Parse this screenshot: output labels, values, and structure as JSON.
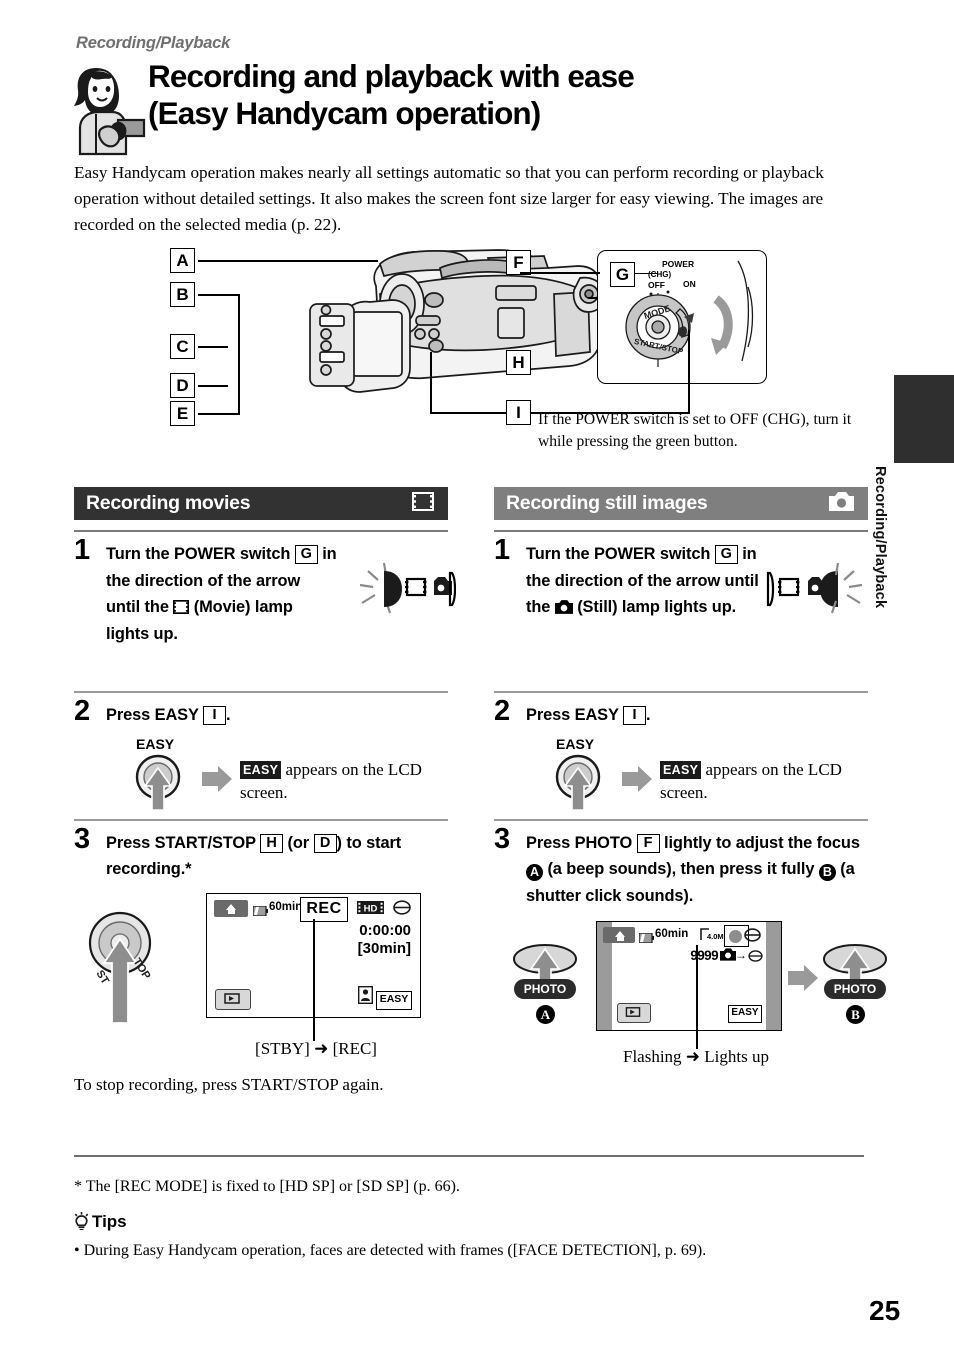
{
  "header": {
    "kicker": "Recording/Playback",
    "title_line1": "Recording and playback with ease",
    "title_line2": "(Easy Handycam operation)",
    "intro": "Easy Handycam operation makes nearly all settings automatic so that you can perform recording or playback operation without detailed settings. It also makes the screen font size larger for easy viewing. The images are recorded on the selected media (p. 22)."
  },
  "side_tab": {
    "label": "Recording/Playback"
  },
  "diagram": {
    "callouts": [
      "A",
      "B",
      "C",
      "D",
      "E",
      "F",
      "H",
      "I"
    ],
    "power_panel": {
      "callout": "G",
      "power_label": "POWER",
      "chg_label": "(CHG)",
      "off_label": "OFF",
      "on_label": "ON",
      "mode_label": "MODE",
      "startstop_label": "START/STOP"
    },
    "note": "If the POWER switch is set to OFF (CHG), turn it while pressing the green button."
  },
  "columns": [
    {
      "section_title": "Recording movies",
      "section_icon": "movie-icon",
      "header_style": "dark",
      "steps": [
        {
          "num": "1",
          "text_parts": [
            "Turn the POWER switch ",
            "G",
            " in the direction of the arrow until the ",
            "movie-icon",
            " (Movie) lamp lights up."
          ],
          "lamp_active": "movie"
        },
        {
          "num": "2",
          "text_pre": "Press EASY ",
          "text_box": "I",
          "text_post": ".",
          "button_label": "EASY",
          "caption_chip": "EASY",
          "caption_text": " appears on the LCD screen."
        },
        {
          "num": "3",
          "text_parts": [
            "Press START/STOP ",
            "H",
            " (or ",
            "D",
            ") to start recording.*"
          ],
          "lcd": {
            "battery": "60min",
            "rec_badge": "REC",
            "format": "HD",
            "timecode": "0:00:00",
            "remaining": "[30min]",
            "easy_tag": "EASY"
          },
          "caption": "[STBY] ➜ [REC]",
          "after_text": "To stop recording, press START/STOP again."
        }
      ]
    },
    {
      "section_title": "Recording still images",
      "section_icon": "still-icon",
      "header_style": "gray",
      "steps": [
        {
          "num": "1",
          "text_parts": [
            "Turn the POWER switch ",
            "G",
            " in the direction of the arrow until the ",
            "still-icon",
            " (Still) lamp lights up."
          ],
          "lamp_active": "still"
        },
        {
          "num": "2",
          "text_pre": "Press EASY ",
          "text_box": "I",
          "text_post": ".",
          "button_label": "EASY",
          "caption_chip": "EASY",
          "caption_text": " appears on the LCD screen."
        },
        {
          "num": "3",
          "text_parts": [
            "Press PHOTO ",
            "F",
            " lightly to adjust the focus ",
            "A",
            " (a beep sounds), then press it fully ",
            "B",
            " (a shutter click sounds)."
          ],
          "lcd": {
            "battery": "60min",
            "size": "4.0M",
            "count": "9999",
            "easy_tag": "EASY"
          },
          "photo_a_label": "PHOTO",
          "photo_a_badge": "A",
          "photo_b_label": "PHOTO",
          "photo_b_badge": "B",
          "caption": "Flashing ➜ Lights up"
        }
      ]
    }
  ],
  "footer": {
    "footnote": "*  The [REC MODE] is fixed to [HD SP] or [SD SP] (p. 66).",
    "tips_heading": "Tips",
    "tip_1": "• During Easy Handycam operation, faces are detected with frames ([FACE DETECTION], p. 69).",
    "page_number": "25"
  }
}
